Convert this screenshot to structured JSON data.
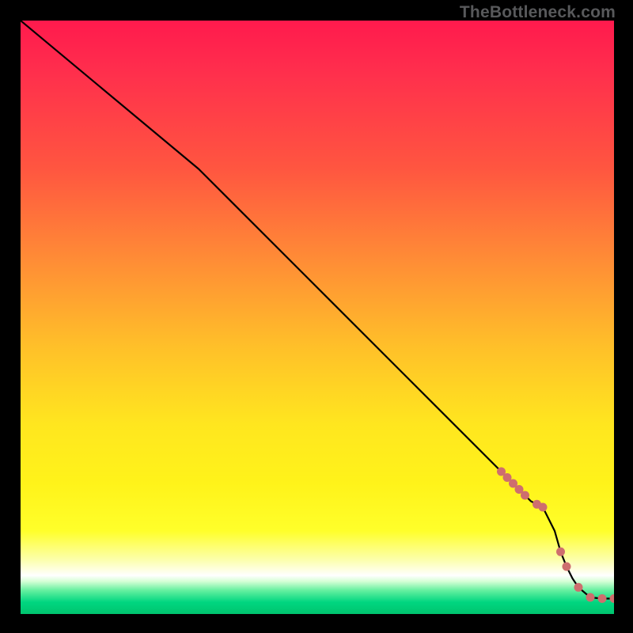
{
  "attribution": "TheBottleneck.com",
  "colors": {
    "dot": "#ce6e6e",
    "curve": "#000000"
  },
  "chart_data": {
    "type": "line",
    "title": "",
    "xlabel": "",
    "ylabel": "",
    "xlim": [
      0,
      100
    ],
    "ylim": [
      0,
      100
    ],
    "grid": false,
    "legend": false,
    "series": [
      {
        "name": "bottleneck_curve",
        "x": [
          0,
          30,
          81,
          82,
          83,
          84,
          85,
          86,
          87,
          88,
          89,
          90,
          91,
          92,
          93,
          94,
          96,
          98,
          100
        ],
        "values": [
          100,
          75,
          24,
          23,
          22,
          21,
          20,
          19,
          18.5,
          18,
          16,
          14,
          10.5,
          8,
          6,
          4.5,
          2.8,
          2.6,
          2.6
        ]
      }
    ],
    "highlight_points": {
      "name": "dotted_segment",
      "x": [
        81,
        82,
        83,
        84,
        85,
        87,
        88,
        91,
        92,
        94,
        96,
        98,
        100
      ],
      "values": [
        24,
        23,
        22,
        21,
        20,
        18.5,
        18,
        10.5,
        8,
        4.5,
        2.8,
        2.6,
        2.6
      ]
    }
  }
}
